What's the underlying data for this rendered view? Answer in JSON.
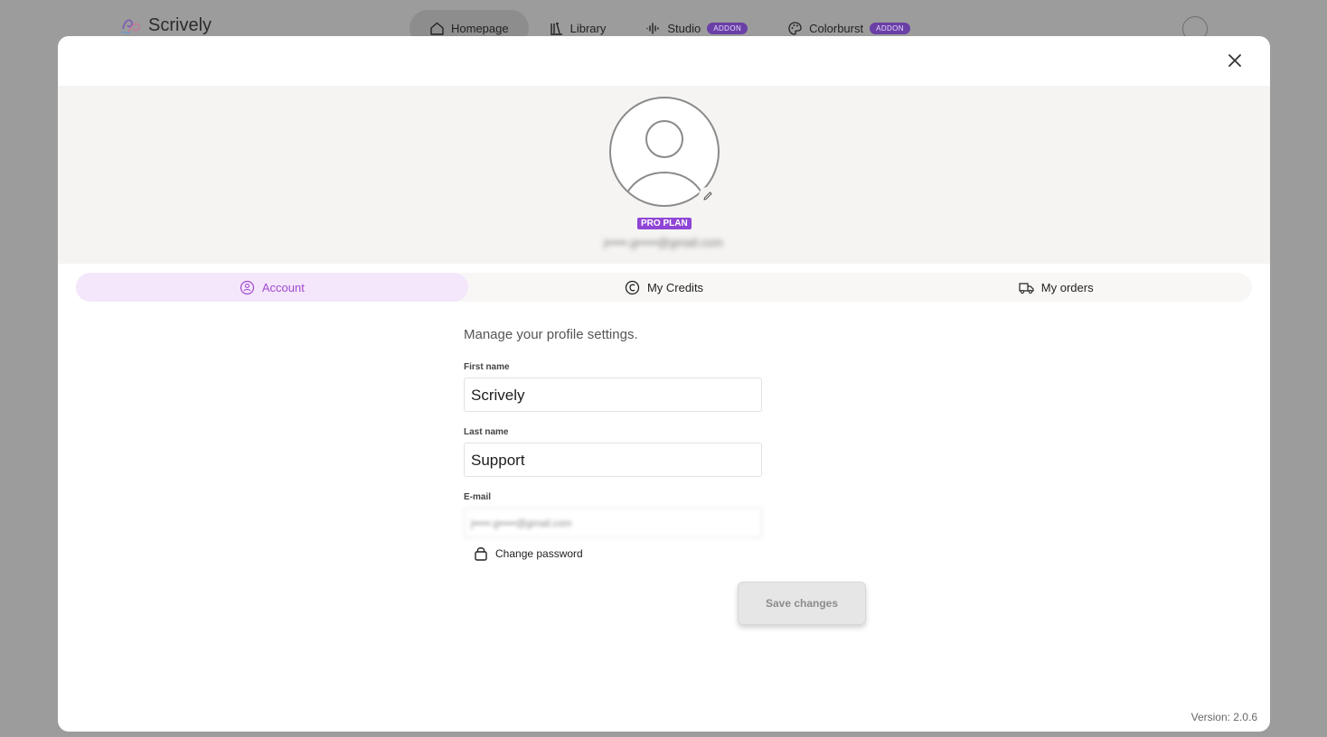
{
  "app": {
    "logo_text": "Scrively",
    "nav": [
      {
        "label": "Homepage",
        "icon": "home-icon",
        "active": true
      },
      {
        "label": "Library",
        "icon": "library-icon"
      },
      {
        "label": "Studio",
        "icon": "audio-wave-icon",
        "badge": "ADDON"
      },
      {
        "label": "Colorburst",
        "icon": "palette-icon",
        "badge": "ADDON"
      }
    ]
  },
  "modal": {
    "plan_badge": "PRO PLAN",
    "email_blurred": "j•••••.g•••••@gmail.com",
    "tabs": [
      {
        "label": "Account",
        "icon": "account-icon",
        "active": true
      },
      {
        "label": "My Credits",
        "icon": "credits-icon"
      },
      {
        "label": "My orders",
        "icon": "truck-icon"
      }
    ],
    "intro": "Manage your profile settings.",
    "first_name_label": "First name",
    "first_name_value": "Scrively",
    "last_name_label": "Last name",
    "last_name_value": "Support",
    "email_label": "E-mail",
    "email_value": "j•••••.g•••••@gmail.com",
    "change_password": "Change password",
    "save_button": "Save changes",
    "version": "Version: 2.0.6"
  },
  "colors": {
    "accent": "#8f45d6",
    "tab_active_bg": "#f4e6fb",
    "tab_active_text": "#a14bd0",
    "addon_badge": "#6a3fa6"
  }
}
